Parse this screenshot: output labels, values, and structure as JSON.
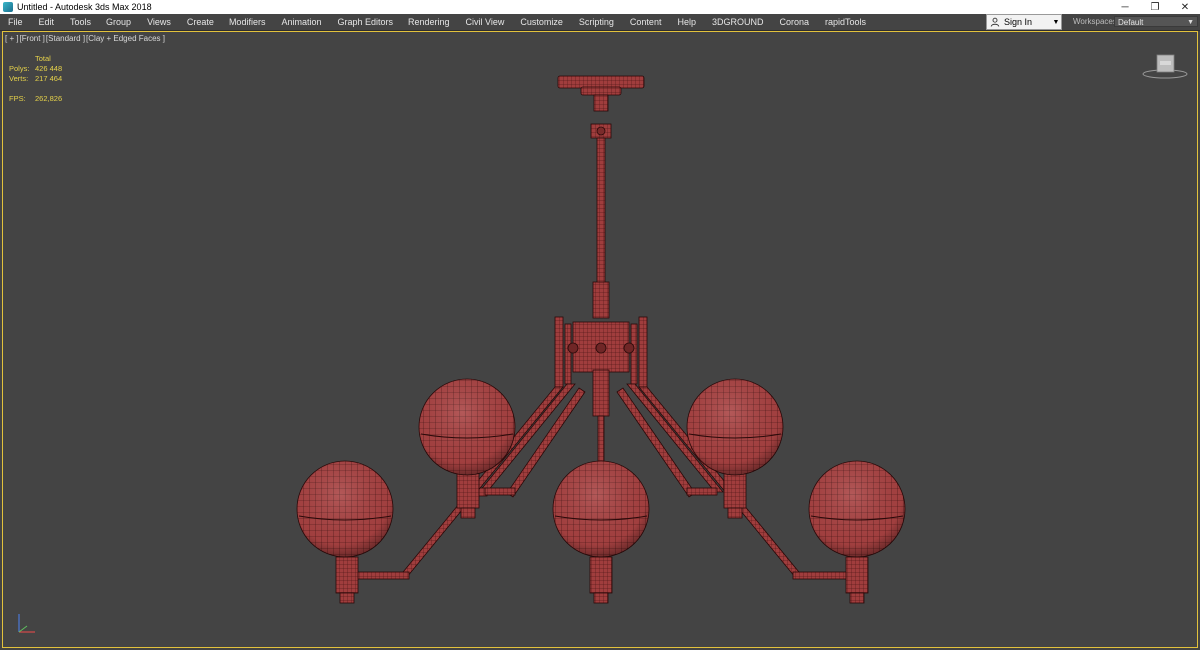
{
  "titlebar": {
    "title": "Untitled - Autodesk 3ds Max 2018",
    "icon": "3dsmax-app-icon",
    "controls": {
      "minimize": "─",
      "restore": "❐",
      "close": "✕"
    }
  },
  "menubar": {
    "items": [
      "File",
      "Edit",
      "Tools",
      "Group",
      "Views",
      "Create",
      "Modifiers",
      "Animation",
      "Graph Editors",
      "Rendering",
      "Civil View",
      "Customize",
      "Scripting",
      "Content",
      "Help",
      "3DGROUND",
      "Corona",
      "rapidTools"
    ],
    "signin": {
      "label": "Sign In",
      "icon": "user-icon"
    },
    "workspaces": {
      "label": "Workspaces:",
      "value": "Default"
    }
  },
  "viewport": {
    "label": {
      "plus": "[ + ]",
      "view": "[Front ]",
      "shading_mode": "[Standard ]",
      "display": "[Clay + Edged Faces ]"
    },
    "stats": {
      "header": "Total",
      "polys_label": "Polys:",
      "polys_value": "426 448",
      "verts_label": "Verts:",
      "verts_value": "217 464",
      "fps_label": "FPS:",
      "fps_value": "262,826"
    },
    "viewcube_label": "viewcube",
    "colors": {
      "background": "#444444",
      "active_border": "#e2c23c",
      "stats_text": "#e6d24a",
      "model_fill": "#a84040",
      "model_wire": "#3a0d0d"
    }
  }
}
